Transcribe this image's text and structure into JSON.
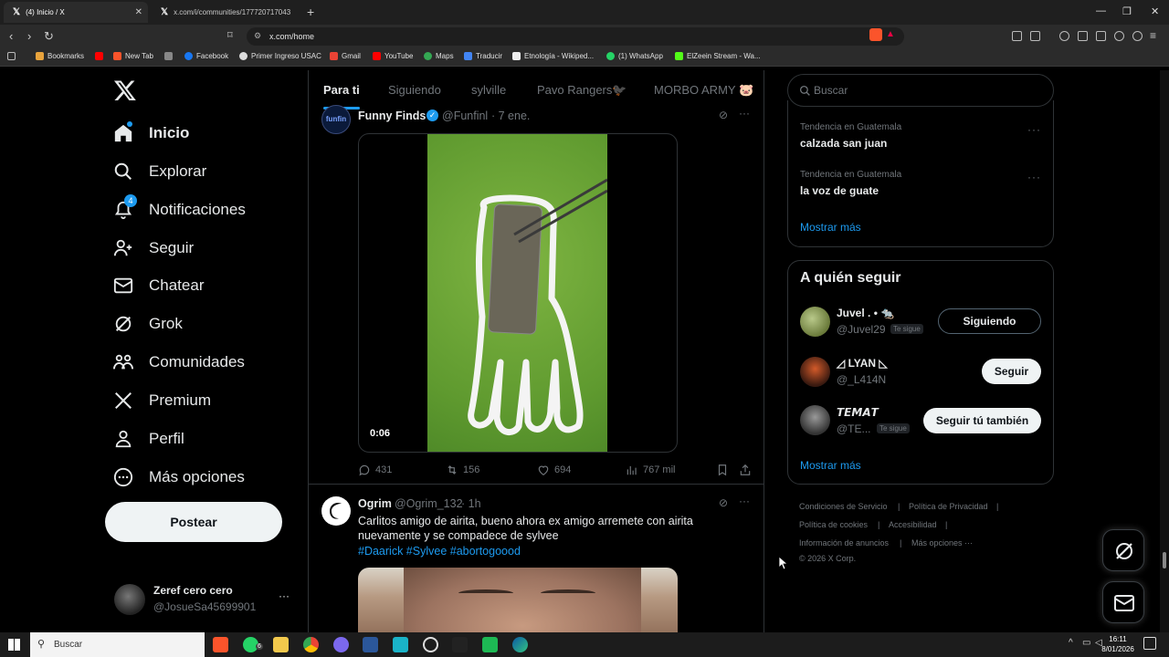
{
  "browser": {
    "tabs": [
      {
        "label": "(4) Inicio / X"
      },
      {
        "label": "x.com/i/communities/177720717043"
      }
    ],
    "url": "x.com/home",
    "bookmarks": [
      "Bookmarks",
      "New Tab",
      "Facebook",
      "Primer Ingreso USAC",
      "Gmail",
      "YouTube",
      "Maps",
      "Traducir",
      "Etnología - Wikiped...",
      "(1) WhatsApp",
      "ElZeein Stream - Wa..."
    ]
  },
  "sidebar": {
    "items": [
      {
        "label": "Inicio"
      },
      {
        "label": "Explorar"
      },
      {
        "label": "Notificaciones",
        "badge": "4"
      },
      {
        "label": "Seguir"
      },
      {
        "label": "Chatear"
      },
      {
        "label": "Grok"
      },
      {
        "label": "Comunidades"
      },
      {
        "label": "Premium"
      },
      {
        "label": "Perfil"
      },
      {
        "label": "Más opciones"
      }
    ],
    "post_label": "Postear",
    "account": {
      "name": "Zeref cero cero",
      "handle": "@JosueSa45699901",
      "more": "···"
    }
  },
  "feed": {
    "tabs": [
      "Para ti",
      "Siguiendo",
      "sylville",
      "Pavo Rangers🐦‍⬛",
      "MORBO ARMY 🐷"
    ],
    "tweet1": {
      "avatar_text": "funfin",
      "name": "Funny Finds",
      "handle": "@Funfinl",
      "time": "· 7 ene.",
      "video_time": "0:06",
      "replies": "431",
      "retweets": "156",
      "likes": "694",
      "views": "767 mil"
    },
    "tweet2": {
      "name": "Ogrim",
      "handle": "@Ogrim_132",
      "time": "· 1h",
      "text": "Carlitos amigo de airita, bueno ahora ex amigo arremete con airita nuevamente y se compadece de sylvee",
      "hashtags": "#Daarick #Sylvee #abortogoood"
    }
  },
  "right": {
    "search_placeholder": "Buscar",
    "trends": [
      {
        "context": "Tendencia en Guatemala",
        "name": "calzada san juan"
      },
      {
        "context": "Tendencia en Guatemala",
        "name": "la voz de guate"
      }
    ],
    "trends_more": "Mostrar más",
    "who_title": "A quién seguir",
    "who": [
      {
        "name": "Juvel . • 🐀",
        "handle": "@Juvel29",
        "tag": "Te sigue",
        "button": "Siguiendo"
      },
      {
        "name": "◿ LYAN ◺",
        "handle": "@_L414N",
        "tag": "",
        "button": "Seguir"
      },
      {
        "name": "𝙏𝙀𝙈𝘼𝙏",
        "handle": "@TE...",
        "tag": "Te sigue",
        "button": "Seguir tú también"
      }
    ],
    "who_more": "Mostrar más",
    "footer": {
      "terms": "Condiciones de Servicio",
      "privacy": "Política de Privacidad",
      "cookies": "Política de cookies",
      "access": "Accesibilidad",
      "ads": "Información de anuncios",
      "more": "Más opciones ···",
      "copyright": "© 2026 X Corp."
    }
  },
  "taskbar": {
    "search_placeholder": "Buscar",
    "time": "16:11",
    "date": "8/01/2026",
    "whatsapp_badge": "6"
  }
}
